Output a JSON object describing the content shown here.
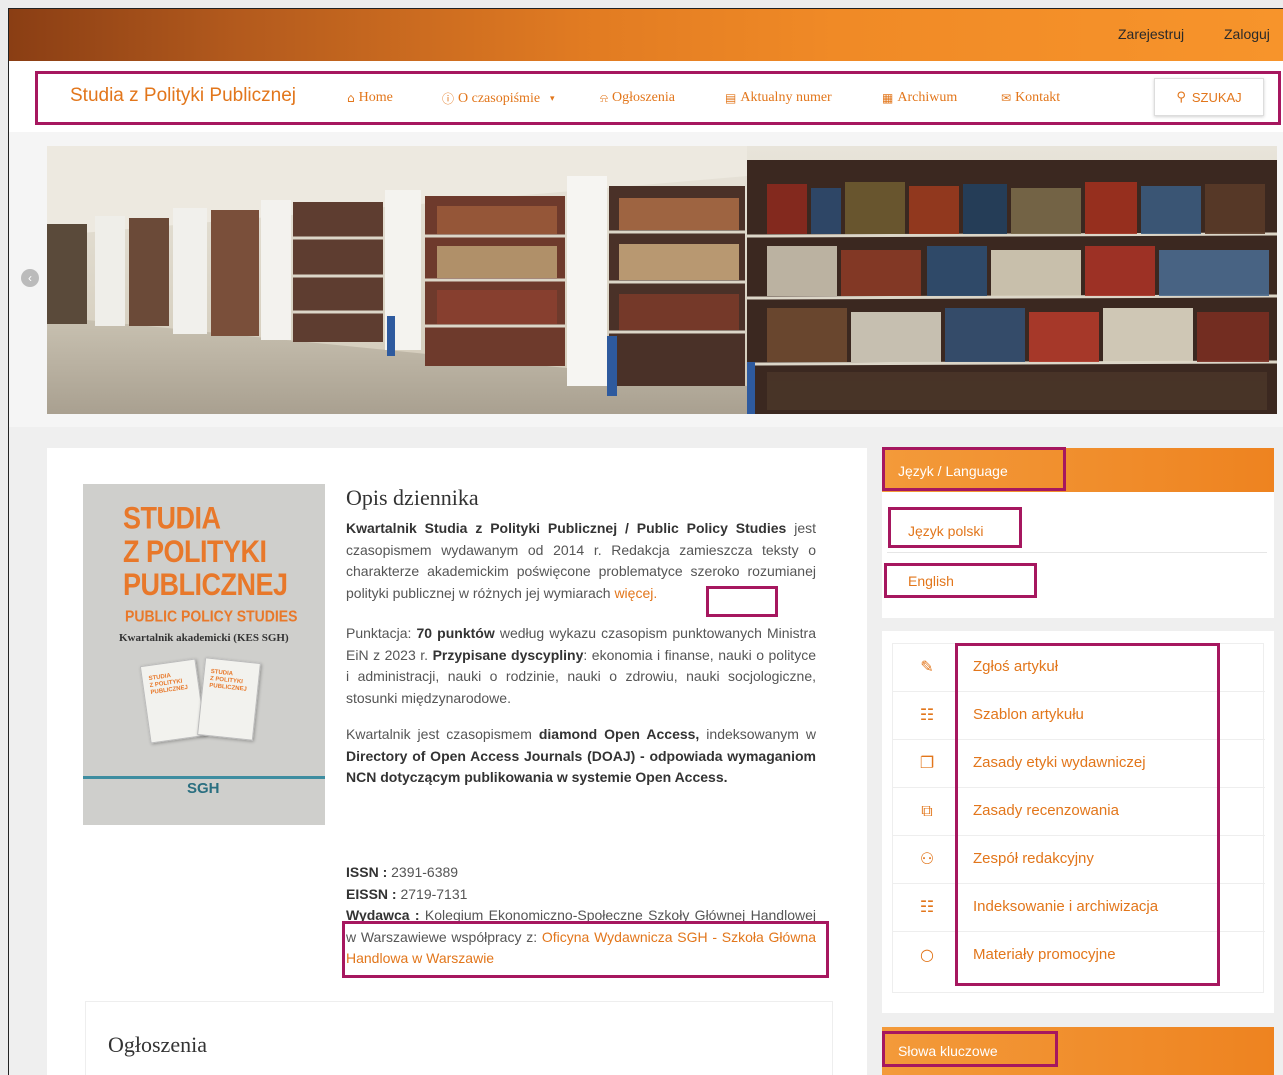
{
  "topbar": {
    "register": "Zarejestruj",
    "login": "Zaloguj"
  },
  "nav": {
    "brand": "Studia z Polityki Publicznej",
    "items": [
      {
        "label": "Home",
        "icon": "home-icon",
        "glyph": "⌂"
      },
      {
        "label": "O czasopiśmie",
        "icon": "info-icon",
        "glyph": "ⓘ"
      },
      {
        "label": "Ogłoszenia",
        "icon": "bell-icon",
        "glyph": "⍾"
      },
      {
        "label": "Aktualny numer",
        "icon": "book-icon",
        "glyph": "▤"
      },
      {
        "label": "Archiwum",
        "icon": "archive-icon",
        "glyph": "▦"
      },
      {
        "label": "Kontakt",
        "icon": "envelope-icon",
        "glyph": "✉"
      }
    ],
    "search_label": "SZUKAJ"
  },
  "cover": {
    "title_lines": [
      "STUDIA",
      "Z POLITYKI",
      "PUBLICZNEJ"
    ],
    "subtitle": "PUBLIC POLICY STUDIES",
    "tagline": "Kwartalnik akademicki (KES SGH)",
    "logo": "SGH"
  },
  "opis": {
    "title": "Opis dziennika",
    "p1_bold": "Kwartalnik Studia z Polityki Publicznej / Public Policy Studies",
    "p1_text": " jest czasopismem wydawanym od 2014 r. Redakcja zamieszcza teksty o charakterze akademickim poświęcone problematyce szeroko rozumianej polityki publicznej w różnych jej wymiarach ",
    "p1_link": "więcej.",
    "p2_a": "Punktacja: ",
    "p2_b1": "70 punktów",
    "p2_c": " według wykazu czasopism punktowanych Ministra EiN z 2023 r. ",
    "p2_b2": "Przypisane dyscypliny",
    "p2_d": ": ekonomia i finanse, nauki o polityce i administracji, nauki o rodzinie, nauki o zdrowiu, nauki socjologiczne, stosunki międzynarodowe.",
    "p3_a": "Kwartalnik jest czasopismem ",
    "p3_b1": "diamond Open Access,",
    "p3_c": " indeksowanym w ",
    "p3_b2": "Directory of Open Access Journals (DOAJ) - odpowiada wymaganiom NCN dotyczącym publikowania w systemie Open Access.",
    "issn_label": "ISSN :",
    "issn": " 2391-6389",
    "eissn_label": "EISSN :",
    "eissn": " 2719-7131",
    "publisher_label": "Wydawca :",
    "publisher_text": " Kolegium Ekonomiczno-Społeczne Szkoły Głównej Handlowej w Warszawiewe współpracy z: ",
    "publisher_link": "Oficyna Wydawnicza SGH - Szkoła Główna Handlowa w Warszawie"
  },
  "announcements": {
    "title": "Ogłoszenia"
  },
  "language": {
    "header": "Język / Language",
    "polish": "Język polski",
    "english": "English"
  },
  "sidebar_links": [
    {
      "label": "Zgłoś artykuł",
      "icon": "edit-icon",
      "glyph": "✎"
    },
    {
      "label": "Szablon artykułu",
      "icon": "document-icon",
      "glyph": "☷"
    },
    {
      "label": "Zasady etyki wydawniczej",
      "icon": "copy-icon",
      "glyph": "❐"
    },
    {
      "label": "Zasady recenzowania",
      "icon": "clone-icon",
      "glyph": "⧉"
    },
    {
      "label": "Zespół redakcyjny",
      "icon": "users-icon",
      "glyph": "⚇"
    },
    {
      "label": "Indeksowanie i archiwizacja",
      "icon": "sitemap-icon",
      "glyph": "☷"
    },
    {
      "label": "Materiały promocyjne",
      "icon": "circle-icon",
      "glyph": "○"
    }
  ],
  "keywords": {
    "header": "Słowa kluczowe"
  },
  "colors": {
    "accent": "#e2761b",
    "highlight_box": "#a6175f",
    "header_orange": "#ee8320"
  }
}
